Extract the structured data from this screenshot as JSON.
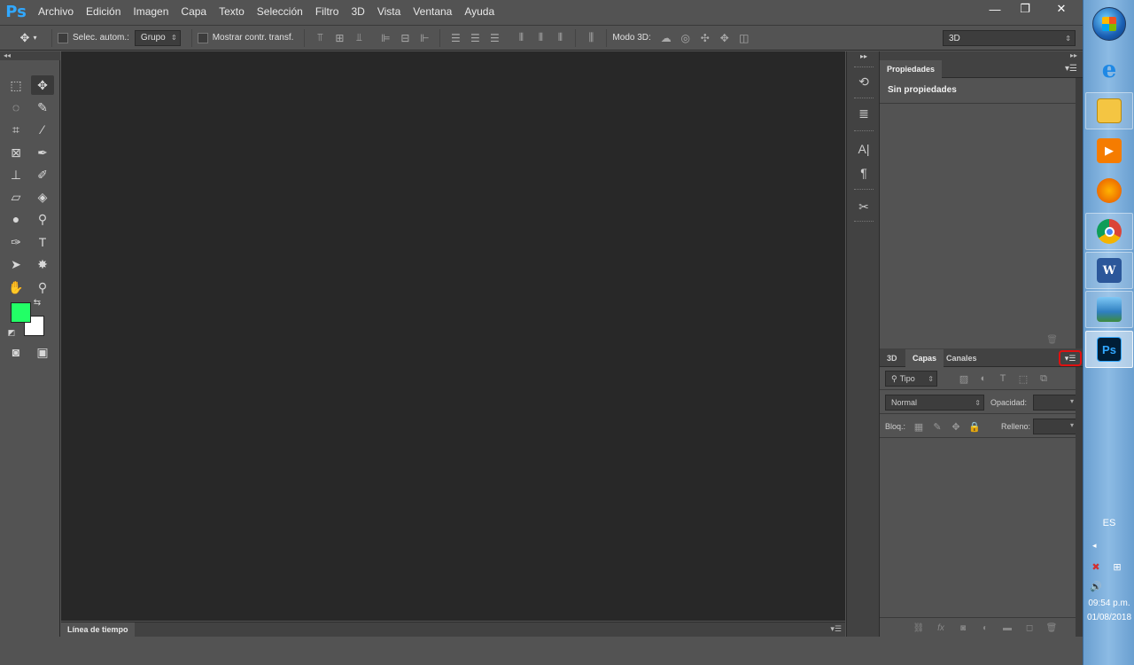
{
  "app": {
    "logo": "Ps"
  },
  "menu": {
    "items": [
      "Archivo",
      "Edición",
      "Imagen",
      "Capa",
      "Texto",
      "Selección",
      "Filtro",
      "3D",
      "Vista",
      "Ventana",
      "Ayuda"
    ]
  },
  "window_controls": {
    "minimize": "—",
    "restore": "❐",
    "close": "✕"
  },
  "options": {
    "auto_select_label": "Selec. autom.:",
    "auto_select_value": "Grupo",
    "show_transform_label": "Mostrar contr. transf.",
    "mode3d_label": "Modo 3D:",
    "workspace_value": "3D"
  },
  "colors": {
    "foreground": "#22ff66",
    "background": "#ffffff",
    "accent_highlight": "#e01010"
  },
  "properties_panel": {
    "tab": "Propiedades",
    "title": "Sin propiedades"
  },
  "layers_panel": {
    "tabs": [
      "3D",
      "Capas",
      "Canales"
    ],
    "active_tab": "Capas",
    "filter_kind": "Tipo",
    "blend_mode": "Normal",
    "opacity_label": "Opacidad:",
    "lock_label": "Bloq.:",
    "fill_label": "Relleno:"
  },
  "timeline": {
    "tab": "Línea de tiempo"
  },
  "taskbar": {
    "language": "ES",
    "time": "09:54 p.m.",
    "date": "01/08/2018"
  }
}
